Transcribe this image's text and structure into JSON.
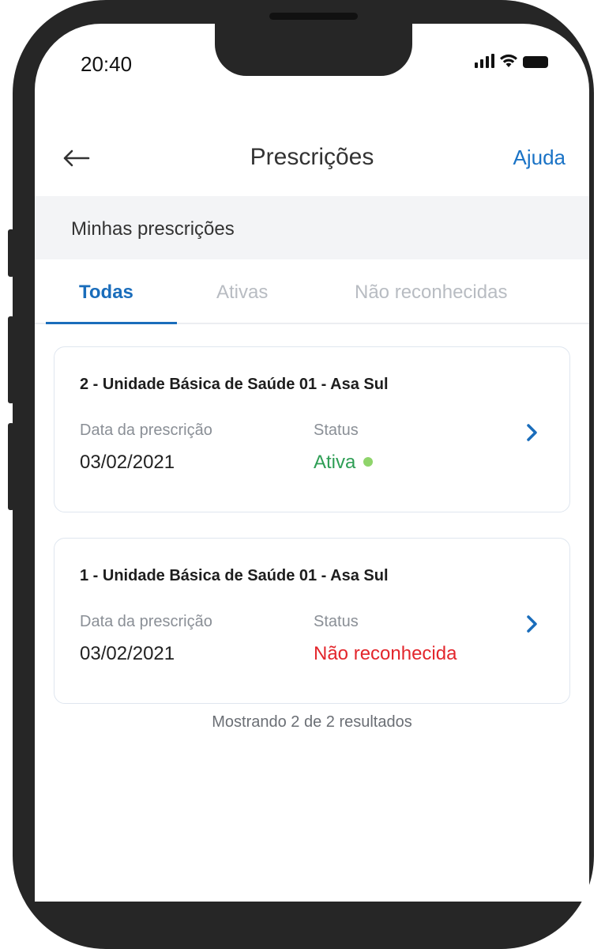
{
  "status_bar": {
    "time": "20:40"
  },
  "header": {
    "title": "Prescrições",
    "help": "Ajuda"
  },
  "section": {
    "title": "Minhas prescrições"
  },
  "tabs": [
    {
      "label": "Todas",
      "active": true
    },
    {
      "label": "Ativas",
      "active": false
    },
    {
      "label": "Não reconhecidas",
      "active": false
    }
  ],
  "prescriptions": [
    {
      "title": "2 - Unidade Básica de Saúde 01 - Asa Sul",
      "date_label": "Data da prescrição",
      "date": "03/02/2021",
      "status_label": "Status",
      "status": "Ativa",
      "status_color": "#2e9e55"
    },
    {
      "title": "1 - Unidade Básica de Saúde 01 - Asa Sul",
      "date_label": "Data da prescrição",
      "date": "03/02/2021",
      "status_label": "Status",
      "status": "Não reconhecida",
      "status_color": "#e3262c"
    }
  ],
  "results_text": "Mostrando 2 de 2 resultados",
  "colors": {
    "accent": "#1a6dbb",
    "active": "#2e9e55",
    "rejected": "#e3262c"
  },
  "icons": {
    "back": "arrow-left-icon",
    "chevron": "chevron-right-icon"
  }
}
